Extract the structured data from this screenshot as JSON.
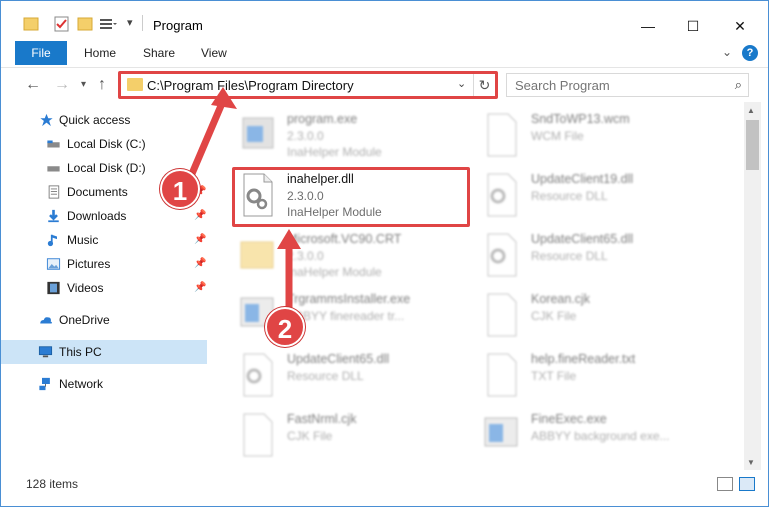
{
  "window": {
    "title": "Program",
    "controls": {
      "minimize": "—",
      "maximize": "☐",
      "close": "✕"
    }
  },
  "ribbon": {
    "tabs": [
      "File",
      "Home",
      "Share",
      "View"
    ],
    "expand_chevron": "⌄",
    "help": "?"
  },
  "nav": {
    "address": "C:\\Program Files\\Program Directory",
    "search_placeholder": "Search Program"
  },
  "sidebar": {
    "items": [
      {
        "label": "Quick access",
        "icon": "star-icon",
        "pinned": false
      },
      {
        "label": "Local Disk (C:)",
        "icon": "drive-icon",
        "pinned": false
      },
      {
        "label": "Local Disk (D:)",
        "icon": "drive-icon",
        "pinned": false
      },
      {
        "label": "Documents",
        "icon": "documents-icon",
        "pinned": true
      },
      {
        "label": "Downloads",
        "icon": "downloads-icon",
        "pinned": true
      },
      {
        "label": "Music",
        "icon": "music-icon",
        "pinned": true
      },
      {
        "label": "Pictures",
        "icon": "pictures-icon",
        "pinned": true
      },
      {
        "label": "Videos",
        "icon": "videos-icon",
        "pinned": true
      },
      {
        "label": "OneDrive",
        "icon": "onedrive-icon",
        "pinned": false
      },
      {
        "label": "This PC",
        "icon": "pc-icon",
        "pinned": false,
        "selected": true
      },
      {
        "label": "Network",
        "icon": "network-icon",
        "pinned": false
      }
    ]
  },
  "files": {
    "left": [
      {
        "name": "program.exe",
        "version": "2.3.0.0",
        "type": "InaHelper Module"
      },
      {
        "name": "inahelper.dll",
        "version": "2.3.0.0",
        "type": "InaHelper Module",
        "highlighted": true
      },
      {
        "name": "Microsoft.VC90.CRT",
        "version": "2.3.0.0",
        "type": "InaHelper Module"
      },
      {
        "name": "TrgrammsInstaller.exe",
        "version": "ABBYY finereader tr...",
        "type": ""
      },
      {
        "name": "UpdateClient65.dll",
        "version": "Resource DLL",
        "type": ""
      },
      {
        "name": "FastNrml.cjk",
        "version": "CJK File",
        "type": ""
      }
    ],
    "right": [
      {
        "name": "SndToWP13.wcm",
        "type": "WCM File"
      },
      {
        "name": "UpdateClient19.dll",
        "type": "Resource DLL"
      },
      {
        "name": "UpdateClient65.dll",
        "type": "Resource DLL"
      },
      {
        "name": "Korean.cjk",
        "type": "CJK File"
      },
      {
        "name": "help.fineReader.txt",
        "type": "TXT File"
      },
      {
        "name": "FineExec.exe",
        "type": "ABBYY background exe..."
      }
    ]
  },
  "status": {
    "item_count": "128 items"
  },
  "annotations": {
    "step1": "1",
    "step2": "2"
  },
  "colors": {
    "accent": "#1979ca",
    "highlight": "#e04545",
    "selected_bg": "#cce4f7"
  }
}
